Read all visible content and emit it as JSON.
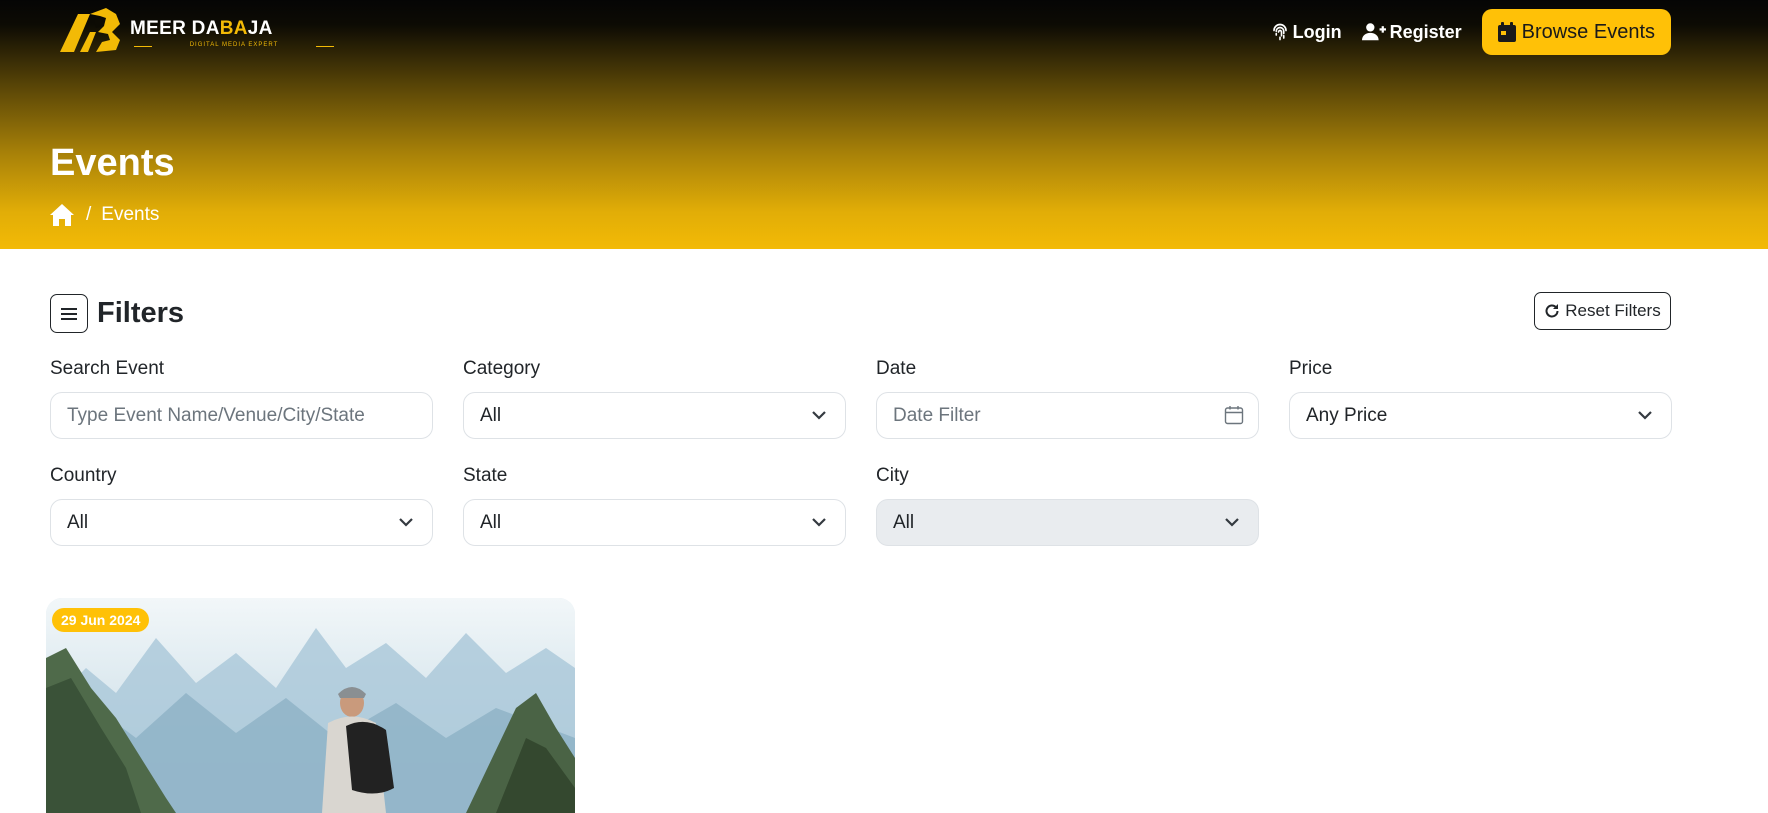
{
  "brand": {
    "name_prefix": "A",
    "name_part1": "MEER DA",
    "name_highlight": "BA",
    "name_part2": "JA",
    "tagline": "DIGITAL MEDIA EXPERT"
  },
  "nav": {
    "login": "Login",
    "register": "Register",
    "browse_events": "Browse Events"
  },
  "page": {
    "title": "Events",
    "breadcrumb_separator": "/",
    "breadcrumb_current": "Events"
  },
  "filters": {
    "title": "Filters",
    "reset_label": "Reset Filters",
    "search": {
      "label": "Search Event",
      "placeholder": "Type Event Name/Venue/City/State",
      "value": ""
    },
    "category": {
      "label": "Category",
      "value": "All"
    },
    "date": {
      "label": "Date",
      "placeholder": "Date Filter",
      "value": ""
    },
    "price": {
      "label": "Price",
      "value": "Any Price"
    },
    "country": {
      "label": "Country",
      "value": "All"
    },
    "state": {
      "label": "State",
      "value": "All"
    },
    "city": {
      "label": "City",
      "value": "All",
      "disabled": true
    }
  },
  "events": [
    {
      "date": "29 Jun 2024",
      "image": "hiker-mountains"
    }
  ],
  "colors": {
    "accent": "#ffc107",
    "hero_top": "#050505",
    "hero_bottom": "#f3ba06",
    "text": "#212529",
    "muted": "#6c757d",
    "border": "#dee2e6",
    "disabled_bg": "#e9ecef"
  }
}
